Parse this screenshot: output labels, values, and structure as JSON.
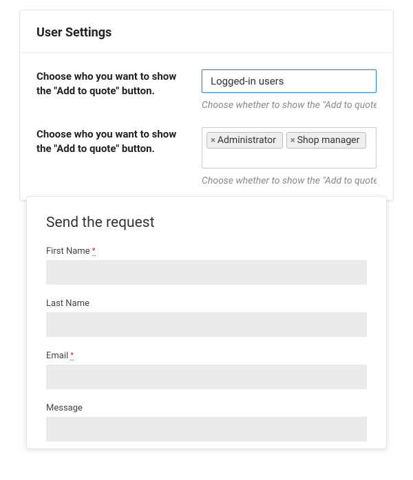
{
  "settings": {
    "title": "User Settings",
    "row1": {
      "label": "Choose who you want to show the \"Add to quote\" button.",
      "selected": "Logged-in users",
      "help": "Choose whether to show the \"Add to quote\""
    },
    "row2": {
      "label": "Choose who you want to show the \"Add to quote\" button.",
      "tags": [
        "Administrator",
        "Shop manager"
      ],
      "help": "Choose whether to show the \"Add to quote\""
    }
  },
  "request": {
    "title": "Send the request",
    "fields": {
      "first_name": {
        "label": "First Name",
        "required": "*",
        "value": ""
      },
      "last_name": {
        "label": "Last Name",
        "value": ""
      },
      "email": {
        "label": "Email",
        "required": "*",
        "value": ""
      },
      "message": {
        "label": "Message",
        "value": ""
      }
    }
  }
}
